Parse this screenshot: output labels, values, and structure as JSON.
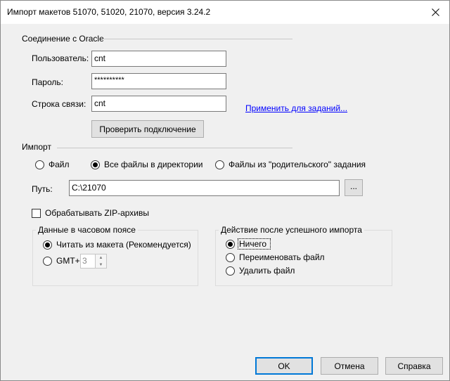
{
  "window": {
    "title": "Импорт макетов 51070, 51020, 21070, версия 3.24.2"
  },
  "oracle": {
    "section_title": "Соединение с Oracle",
    "user_label": "Пользователь:",
    "user_value": "cnt",
    "password_label": "Пароль:",
    "password_value": "**********",
    "connstr_label": "Строка связи:",
    "connstr_value": "cnt",
    "apply_link": "Применить для заданий...",
    "test_button": "Проверить подключение"
  },
  "import": {
    "section_title": "Импорт",
    "mode_file": "Файл",
    "mode_dir": "Все файлы в директории",
    "mode_parent": "Файлы из \"родительского\" задания",
    "selected_mode": "Все файлы в директории",
    "path_label": "Путь:",
    "path_value": "C:\\21070",
    "browse_button": "...",
    "zip_label": "Обрабатывать ZIP-архивы",
    "zip_checked": false
  },
  "timezone": {
    "group_title": "Данные в часовом поясе",
    "from_layout": "Читать из макета (Рекомендуется)",
    "gmt_label": "GMT+",
    "gmt_value": "3",
    "selected": "Читать из макета (Рекомендуется)"
  },
  "after_import": {
    "group_title": "Действие после успешного импорта",
    "nothing": "Ничего",
    "rename": "Переименовать файл",
    "delete": "Удалить файл",
    "selected": "Ничего"
  },
  "buttons": {
    "ok": "OK",
    "cancel": "Отмена",
    "help": "Справка"
  },
  "icons": {
    "close": "close-icon",
    "spin_up": "chevron-up-icon",
    "spin_down": "chevron-down-icon"
  }
}
